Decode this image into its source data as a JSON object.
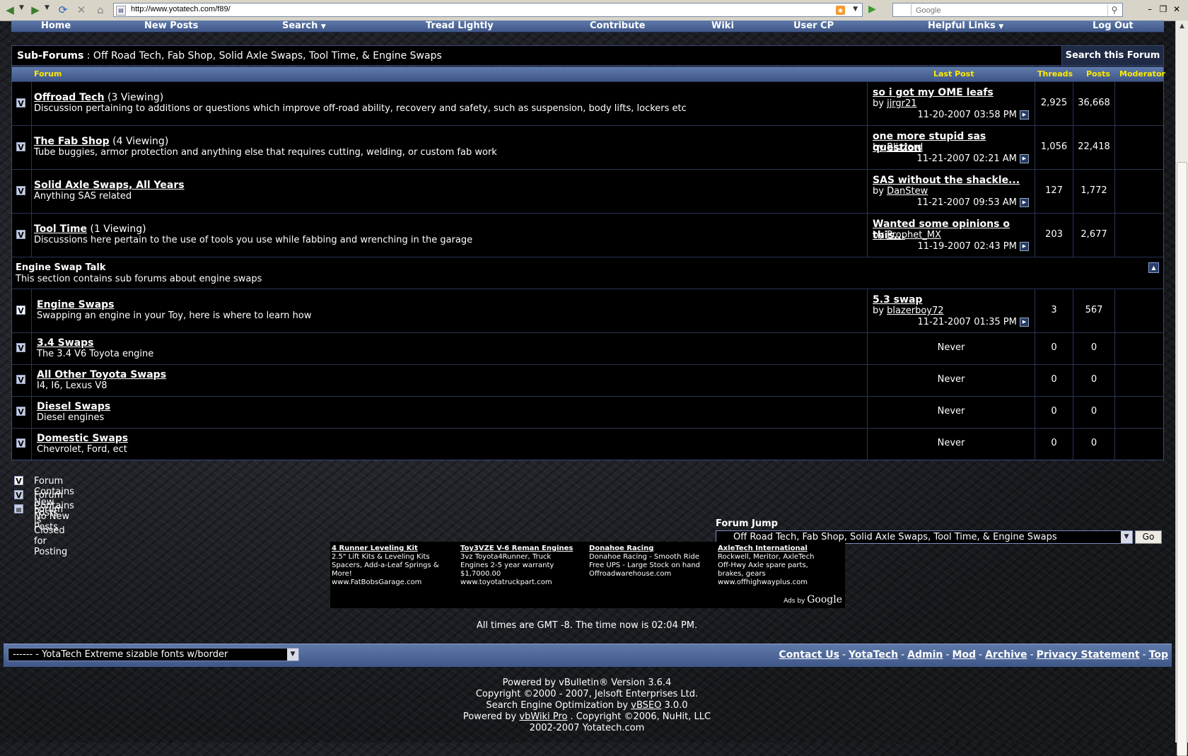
{
  "browser": {
    "url": "http://www.yotatech.com/f89/",
    "search_placeholder": "Google",
    "google_glyph": "G"
  },
  "navbar": {
    "home": "Home",
    "new_posts": "New Posts",
    "search": "Search",
    "tread_lightly": "Tread Lightly",
    "contribute": "Contribute",
    "wiki": "Wiki",
    "user_cp": "User CP",
    "helpful_links": "Helpful Links",
    "log_out": "Log Out"
  },
  "subforums": {
    "label": "Sub-Forums",
    "colon": " : ",
    "path": "Off Road Tech, Fab Shop, Solid Axle Swaps, Tool Time, & Engine Swaps",
    "search_button": "Search this Forum"
  },
  "table": {
    "headers": {
      "forum": "Forum",
      "last_post": "Last Post",
      "threads": "Threads",
      "posts": "Posts",
      "moderator": "Moderator"
    },
    "forums": [
      {
        "name": "Offroad Tech",
        "viewing": " (3 Viewing)",
        "desc": "Discussion pertaining to additions or questions which improve off-road ability, recovery and safety, such as suspension, body lifts, lockers etc",
        "last_title": "so i got my OME leafs",
        "by": "by ",
        "last_user": "jjrgr21",
        "last_date": "11-20-2007",
        "last_time": "03:58 PM",
        "threads": "2,925",
        "posts": "36,668"
      },
      {
        "name": "The Fab Shop",
        "viewing": " (4 Viewing)",
        "desc": "Tube buggies, armor protection and anything else that requires cutting, welding, or custom fab work",
        "last_title": "one more stupid sas question",
        "by": "by ",
        "last_user": "Blizzard",
        "last_date": "11-21-2007",
        "last_time": "02:21 AM",
        "threads": "1,056",
        "posts": "22,418"
      },
      {
        "name": "Solid Axle Swaps, All Years",
        "viewing": "",
        "desc": "Anything SAS related",
        "last_title": "SAS without the shackle...",
        "by": "by ",
        "last_user": "DanStew",
        "last_date": "11-21-2007",
        "last_time": "09:53 AM",
        "threads": "127",
        "posts": "1,772"
      },
      {
        "name": "Tool Time",
        "viewing": " (1 Viewing)",
        "desc": "Discussions here pertain to the use of tools you use while fabbing and wrenching in the garage",
        "last_title": "Wanted some opinions o this...",
        "by": "by ",
        "last_user": "Prophet_MX",
        "last_date": "11-19-2007",
        "last_time": "02:43 PM",
        "threads": "203",
        "posts": "2,677"
      }
    ],
    "category": {
      "title": "Engine Swap Talk",
      "desc": "This section contains sub forums about engine swaps"
    },
    "engine_forums": [
      {
        "name": "Engine Swaps",
        "desc": "Swapping an engine in your Toy, here is where to learn how",
        "last_title": "5.3 swap",
        "by": "by ",
        "last_user": "blazerboy72",
        "last_date": "11-21-2007",
        "last_time": "01:35 PM",
        "threads": "3",
        "posts": "567"
      },
      {
        "name": "3.4 Swaps",
        "desc": "The 3.4 V6 Toyota engine",
        "never": "Never",
        "threads": "0",
        "posts": "0"
      },
      {
        "name": "All Other Toyota Swaps",
        "desc": "I4, I6, Lexus V8",
        "never": "Never",
        "threads": "0",
        "posts": "0"
      },
      {
        "name": "Diesel Swaps",
        "desc": "Diesel engines",
        "never": "Never",
        "threads": "0",
        "posts": "0"
      },
      {
        "name": "Domestic Swaps",
        "desc": "Chevrolet, Ford, ect",
        "never": "Never",
        "threads": "0",
        "posts": "0"
      }
    ]
  },
  "legend": {
    "new_posts": "Forum Contains New Posts",
    "no_new_posts": "Forum Contains No New Posts",
    "closed": "Forum is Closed for Posting"
  },
  "forum_jump": {
    "label": "Forum Jump",
    "selected": "Off Road Tech, Fab Shop, Solid Axle Swaps, Tool Time, & Engine Swaps",
    "go": "Go"
  },
  "ads": {
    "items": [
      {
        "title": "4 Runner Leveling Kit",
        "l1": "2.5\" Lift Kits & Leveling Kits",
        "l2": "Spacers, Add-a-Leaf Springs &",
        "l3": "More!",
        "l4": "www.FatBobsGarage.com"
      },
      {
        "title": "Toy3VZE V-6 Reman Engines",
        "l1": "3vz Toyota4Runner, Truck",
        "l2": "Engines 2-5 year warranty",
        "l3": "$1,7000.00",
        "l4": "www.toyotatruckpart.com"
      },
      {
        "title": "Donahoe Racing",
        "l1": "Donahoe Racing - Smooth Ride",
        "l2": "Free UPS - Large Stock on hand",
        "l3": "Offroadwarehouse.com",
        "l4": ""
      },
      {
        "title": "AxleTech International",
        "l1": "Rockwell, Meritor, AxleTech",
        "l2": "Off-Hwy Axle spare parts,",
        "l3": "brakes, gears",
        "l4": "www.offhighwayplus.com"
      }
    ],
    "ads_by": "Ads by ",
    "google": "Google"
  },
  "time_note": {
    "prefix": "All times are GMT -8. The time now is ",
    "time": "02:04 PM",
    "suffix": "."
  },
  "footer": {
    "style_selected": "------ - YotaTech Extreme sizable fonts w/border",
    "links": [
      "Contact Us",
      "YotaTech",
      "Admin",
      "Mod",
      "Archive",
      "Privacy Statement",
      "Top"
    ],
    "sep": "-"
  },
  "copyright": {
    "line1": "Powered by vBulletin® Version 3.6.4",
    "line2": "Copyright ©2000 - 2007, Jelsoft Enterprises Ltd.",
    "line3_pre": "Search Engine Optimization by ",
    "line3_link": "vBSEO",
    "line3_post": " 3.0.0",
    "line4_pre": "Powered by ",
    "line4_link": "vbWiki Pro",
    "line4_post": " . Copyright ©2006, NuHit, LLC",
    "line5": "2002-2007 Yotatech.com"
  },
  "icons": {
    "forum_new": "V",
    "collapse": "▲",
    "goto": "▶"
  }
}
